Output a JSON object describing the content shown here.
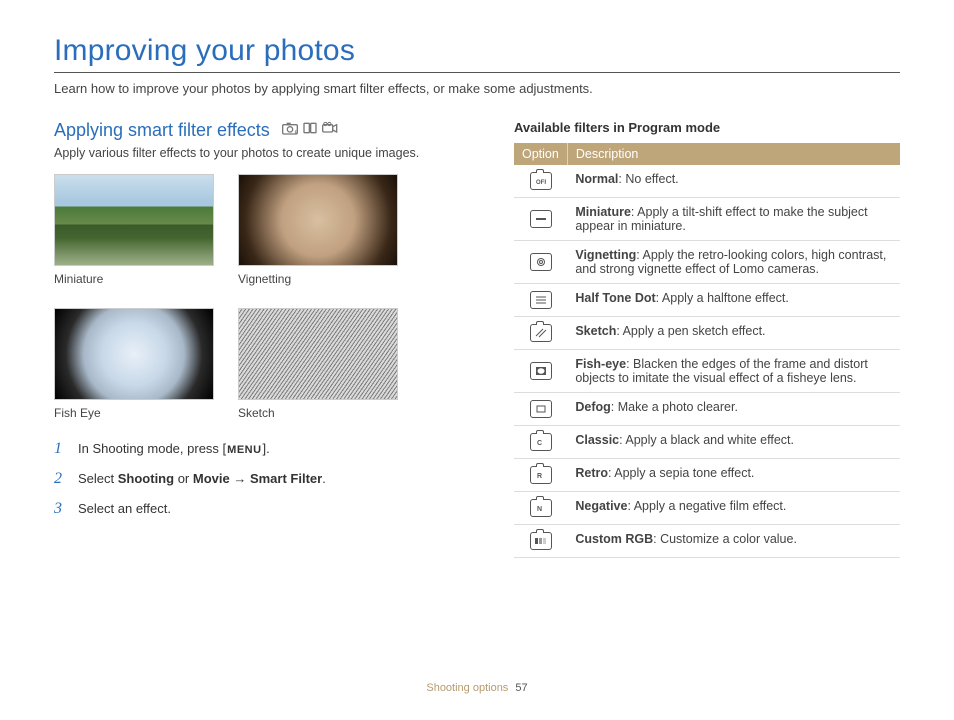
{
  "page": {
    "title": "Improving your photos",
    "intro": "Learn how to improve your photos by applying smart filter effects, or make some adjustments."
  },
  "left": {
    "heading": "Applying smart filter effects",
    "desc": "Apply various filter effects to your photos to create unique images.",
    "thumbs": [
      {
        "caption": "Miniature"
      },
      {
        "caption": "Vignetting"
      },
      {
        "caption": "Fish Eye"
      },
      {
        "caption": "Sketch"
      }
    ],
    "steps": {
      "s1_a": "In Shooting mode, press [",
      "s1_menu": "MENU",
      "s1_b": "].",
      "s2_a": "Select ",
      "s2_b1": "Shooting",
      "s2_mid": " or ",
      "s2_b2": "Movie",
      "s2_arrow": " → ",
      "s2_b3": "Smart Filter",
      "s2_end": ".",
      "s3": "Select an effect."
    }
  },
  "right": {
    "heading": "Available filters in Program mode",
    "th_option": "Option",
    "th_desc": "Description",
    "rows": [
      {
        "name": "Normal",
        "desc": ": No effect."
      },
      {
        "name": "Miniature",
        "desc": ": Apply a tilt-shift effect to make the subject appear in miniature."
      },
      {
        "name": "Vignetting",
        "desc": ": Apply the retro-looking colors, high contrast, and strong vignette effect of Lomo cameras."
      },
      {
        "name": "Half Tone Dot",
        "desc": ": Apply a halftone effect."
      },
      {
        "name": "Sketch",
        "desc": ": Apply a pen sketch effect."
      },
      {
        "name": "Fish-eye",
        "desc": ": Blacken the edges of the frame and distort objects to imitate the visual effect of a fisheye lens."
      },
      {
        "name": "Defog",
        "desc": ": Make a photo clearer."
      },
      {
        "name": "Classic",
        "desc": ": Apply a black and white effect."
      },
      {
        "name": "Retro",
        "desc": ": Apply a sepia tone effect."
      },
      {
        "name": "Negative",
        "desc": ": Apply a negative film effect."
      },
      {
        "name": "Custom RGB",
        "desc": ": Customize a color value."
      }
    ]
  },
  "footer": {
    "section": "Shooting options",
    "page": "57"
  }
}
